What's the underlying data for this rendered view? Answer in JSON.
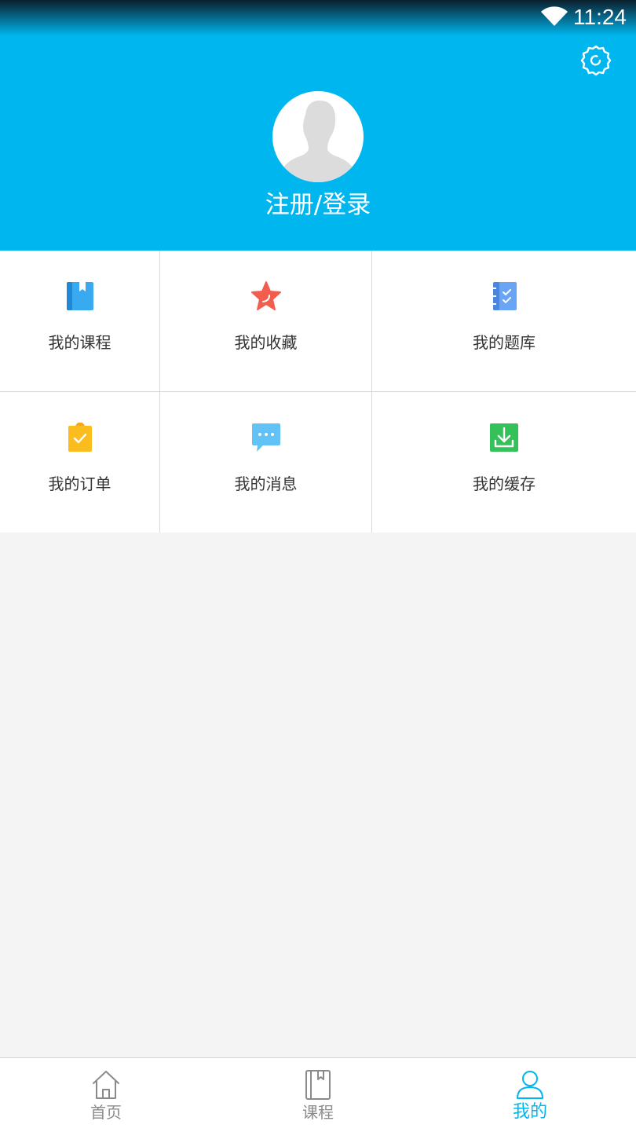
{
  "status_bar": {
    "time": "11:24",
    "wifi_icon": "wifi-icon"
  },
  "header": {
    "background_color": "#00b6ef",
    "settings_icon": "gear-icon",
    "avatar_icon": "default-avatar-icon",
    "login_text": "注册/登录"
  },
  "menu": {
    "items": [
      {
        "label": "我的课程",
        "icon": "book-icon",
        "color": "#3aaaf0"
      },
      {
        "label": "我的收藏",
        "icon": "star-icon",
        "color": "#f25d4e"
      },
      {
        "label": "我的题库",
        "icon": "notebook-check-icon",
        "color": "#6aa4f5"
      },
      {
        "label": "我的订单",
        "icon": "clipboard-check-icon",
        "color": "#fbbd1e"
      },
      {
        "label": "我的消息",
        "icon": "chat-bubble-icon",
        "color": "#62c2f5"
      },
      {
        "label": "我的缓存",
        "icon": "download-icon",
        "color": "#35c15a"
      }
    ]
  },
  "bottom_nav": {
    "items": [
      {
        "label": "首页",
        "icon": "home-icon",
        "active": false
      },
      {
        "label": "课程",
        "icon": "book-icon",
        "active": false
      },
      {
        "label": "我的",
        "icon": "user-icon",
        "active": true
      }
    ],
    "active_color": "#00b6ef",
    "inactive_color": "#8a8a8a"
  }
}
